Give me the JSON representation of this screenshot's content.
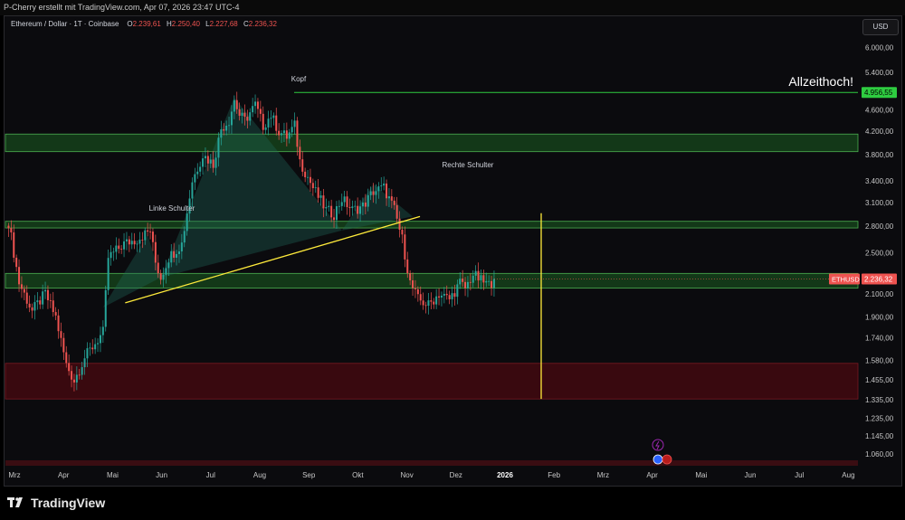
{
  "header": {
    "credit": "P-Cherry erstellt mit TradingView.com, Apr 07, 2026 23:47 UTC-4"
  },
  "legend": {
    "symbol": "Ethereum / Dollar · 1T · Coinbase",
    "o_key": "O",
    "o_val": "2.239,61",
    "h_key": "H",
    "h_val": "2.250,40",
    "l_key": "L",
    "l_val": "2.227,68",
    "c_key": "C",
    "c_val": "2.236,32"
  },
  "currency_button": "USD",
  "footer": {
    "brand": "TradingView"
  },
  "colors": {
    "up": "#26a69a",
    "down": "#ef5350",
    "zone_green": "#1b5e20",
    "zone_green_line": "#4caf50",
    "zone_red": "#4a0a10",
    "trendline": "#ffeb3b",
    "ath_label": "#2ecc40",
    "price_label": "#ef5350"
  },
  "chart_data": {
    "type": "candlestick",
    "title": "",
    "scale": "log",
    "ylim": [
      1000,
      6400
    ],
    "y_ticks": [
      {
        "v": 6000,
        "label": "6.000,00"
      },
      {
        "v": 5400,
        "label": "5.400,00"
      },
      {
        "v": 4600,
        "label": "4.600,00"
      },
      {
        "v": 4200,
        "label": "4.200,00"
      },
      {
        "v": 3800,
        "label": "3.800,00"
      },
      {
        "v": 3400,
        "label": "3.400,00"
      },
      {
        "v": 3100,
        "label": "3.100,00"
      },
      {
        "v": 2800,
        "label": "2.800,00"
      },
      {
        "v": 2500,
        "label": "2.500,00"
      },
      {
        "v": 2100,
        "label": "2.100,00"
      },
      {
        "v": 1900,
        "label": "1.900,00"
      },
      {
        "v": 1740,
        "label": "1.740,00"
      },
      {
        "v": 1580,
        "label": "1.580,00"
      },
      {
        "v": 1455,
        "label": "1.455,00"
      },
      {
        "v": 1335,
        "label": "1.335,00"
      },
      {
        "v": 1235,
        "label": "1.235,00"
      },
      {
        "v": 1145,
        "label": "1.145,00"
      },
      {
        "v": 1060,
        "label": "1.060,00"
      }
    ],
    "x_labels": [
      {
        "label": "Mrz",
        "bold": false
      },
      {
        "label": "Apr",
        "bold": false
      },
      {
        "label": "Mai",
        "bold": false
      },
      {
        "label": "Jun",
        "bold": false
      },
      {
        "label": "Jul",
        "bold": false
      },
      {
        "label": "Aug",
        "bold": false
      },
      {
        "label": "Sep",
        "bold": false
      },
      {
        "label": "Okt",
        "bold": false
      },
      {
        "label": "Nov",
        "bold": false
      },
      {
        "label": "Dez",
        "bold": false
      },
      {
        "label": "2026",
        "bold": true
      },
      {
        "label": "Feb",
        "bold": false
      },
      {
        "label": "Mrz",
        "bold": false
      },
      {
        "label": "Apr",
        "bold": false
      },
      {
        "label": "Mai",
        "bold": false
      },
      {
        "label": "Jun",
        "bold": false
      },
      {
        "label": "Jul",
        "bold": false
      },
      {
        "label": "Aug",
        "bold": false
      }
    ],
    "price_path": [
      [
        0,
        2850
      ],
      [
        4,
        2200
      ],
      [
        9,
        1950
      ],
      [
        14,
        2100
      ],
      [
        18,
        1900
      ],
      [
        22,
        1550
      ],
      [
        25,
        1450
      ],
      [
        29,
        1600
      ],
      [
        33,
        1700
      ],
      [
        36,
        1780
      ],
      [
        38,
        2450
      ],
      [
        44,
        2600
      ],
      [
        49,
        2650
      ],
      [
        54,
        2750
      ],
      [
        56,
        2400
      ],
      [
        58,
        2250
      ],
      [
        61,
        2450
      ],
      [
        66,
        2600
      ],
      [
        70,
        3400
      ],
      [
        74,
        3800
      ],
      [
        78,
        3650
      ],
      [
        81,
        4250
      ],
      [
        84,
        4400
      ],
      [
        86,
        4800
      ],
      [
        88,
        4500
      ],
      [
        90,
        4400
      ],
      [
        94,
        4700
      ],
      [
        97,
        4300
      ],
      [
        100,
        4500
      ],
      [
        103,
        4200
      ],
      [
        106,
        4100
      ],
      [
        109,
        4300
      ],
      [
        111,
        3700
      ],
      [
        116,
        3300
      ],
      [
        121,
        3000
      ],
      [
        124,
        2950
      ],
      [
        127,
        3150
      ],
      [
        131,
        3000
      ],
      [
        135,
        3050
      ],
      [
        139,
        3250
      ],
      [
        143,
        3300
      ],
      [
        147,
        3000
      ],
      [
        150,
        2650
      ],
      [
        153,
        2200
      ],
      [
        156,
        2050
      ],
      [
        160,
        2000
      ],
      [
        164,
        2100
      ],
      [
        168,
        2050
      ],
      [
        172,
        2200
      ],
      [
        174,
        2150
      ],
      [
        177,
        2280
      ],
      [
        180,
        2220
      ],
      [
        183,
        2180
      ],
      [
        185,
        2237
      ]
    ],
    "zones": [
      {
        "type": "resistance",
        "low": 3850,
        "high": 4150
      },
      {
        "type": "support",
        "low": 2780,
        "high": 2860
      },
      {
        "type": "support",
        "low": 2150,
        "high": 2290
      },
      {
        "type": "demand",
        "low": 1340,
        "high": 1560
      }
    ],
    "ath": {
      "value": 4956.55,
      "label": "4.956,55",
      "text": "Allzeithoch!"
    },
    "current_price": {
      "symbol": "ETHUSD",
      "label": "2.236,32",
      "value": 2236.32
    },
    "neckline": {
      "from": [
        1,
        2020
      ],
      "to": [
        154,
        2920
      ]
    },
    "projection": {
      "x": 153,
      "from": 2960,
      "to": 1340
    },
    "annotations": [
      "Linke Schulter",
      "Kopf",
      "Rechte Schulter"
    ]
  }
}
